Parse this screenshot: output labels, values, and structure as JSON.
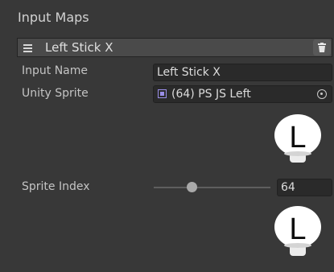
{
  "panel": {
    "title": "Input Maps"
  },
  "element": {
    "name": "Left Stick X"
  },
  "fields": {
    "input_name": {
      "label": "Input Name",
      "value": "Left Stick X"
    },
    "unity_sprite": {
      "label": "Unity Sprite",
      "value": "(64) PS JS Left"
    },
    "sprite_index": {
      "label": "Sprite Index",
      "value": "64",
      "slider_fraction": 0.33
    }
  },
  "sprite_glyph": "L",
  "icons": {
    "menu": "hamburger-menu-icon",
    "delete": "trash-icon",
    "sprite": "sprite-asset-icon",
    "picker": "object-picker-icon"
  }
}
